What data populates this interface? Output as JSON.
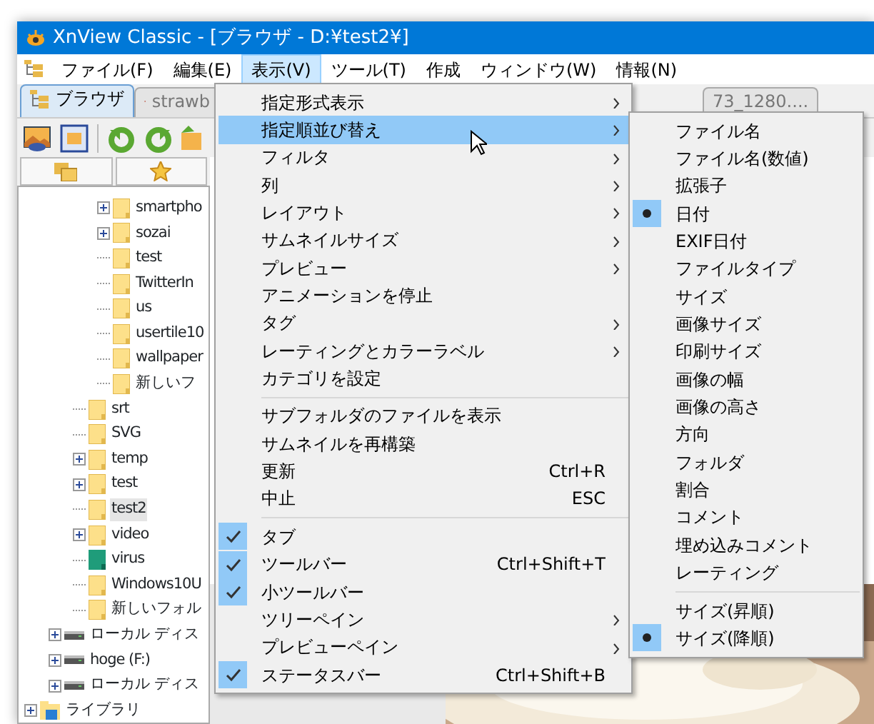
{
  "window": {
    "title": "XnView Classic - [ブラウザ - D:¥test2¥]"
  },
  "menu_bar": [
    {
      "label": "ファイル(F)",
      "selected": false
    },
    {
      "label": "編集(E)",
      "selected": false
    },
    {
      "label": "表示(V)",
      "selected": true
    },
    {
      "label": "ツール(T)",
      "selected": false
    },
    {
      "label": "作成",
      "selected": false
    },
    {
      "label": "ウィンドウ(W)",
      "selected": false
    },
    {
      "label": "情報(N)",
      "selected": false
    }
  ],
  "tabs": [
    {
      "label": "ブラウザ",
      "selected": true
    },
    {
      "label": "strawb",
      "selected": false
    },
    {
      "label": "73_1280....",
      "selected": false
    }
  ],
  "tree": [
    {
      "children": [
        {
          "children": [
            {
              "children": [
                {
                  "label": "smartpho",
                  "kind": "folder",
                  "expander": true,
                  "selected": false
                },
                {
                  "label": "sozai",
                  "kind": "folder",
                  "expander": true,
                  "selected": false
                },
                {
                  "label": "test",
                  "kind": "folder",
                  "expander": false,
                  "selected": false
                },
                {
                  "label": "TwitterIn",
                  "kind": "folder",
                  "expander": false,
                  "selected": false
                },
                {
                  "label": "us",
                  "kind": "folder",
                  "expander": false,
                  "selected": false
                },
                {
                  "label": "usertile10",
                  "kind": "folder",
                  "expander": false,
                  "selected": false
                },
                {
                  "label": "wallpaper",
                  "kind": "folder",
                  "expander": false,
                  "selected": false
                },
                {
                  "label": "新しいフ",
                  "kind": "folder",
                  "expander": false,
                  "selected": false
                }
              ]
            },
            {
              "label": "srt",
              "kind": "folder",
              "expander": false,
              "selected": false
            },
            {
              "label": "SVG",
              "kind": "folder",
              "expander": false,
              "selected": false
            },
            {
              "label": "temp",
              "kind": "folder",
              "expander": true,
              "selected": false
            },
            {
              "label": "test",
              "kind": "folder",
              "expander": true,
              "selected": false
            },
            {
              "label": "test2",
              "kind": "folder",
              "expander": false,
              "selected": true
            },
            {
              "label": "video",
              "kind": "folder",
              "expander": true,
              "selected": false
            },
            {
              "label": "virus",
              "kind": "folder_teal",
              "expander": false,
              "selected": false
            },
            {
              "label": "Windows10U",
              "kind": "folder",
              "expander": false,
              "selected": false
            },
            {
              "label": "新しいフォル",
              "kind": "folder",
              "expander": false,
              "selected": false
            }
          ]
        },
        {
          "label": "ローカル ディス",
          "kind": "drive",
          "expander": true,
          "selected": false
        },
        {
          "label": "hoge (F:)",
          "kind": "drive",
          "expander": true,
          "selected": false
        },
        {
          "label": "ローカル ディス",
          "kind": "drive",
          "expander": true,
          "selected": false
        }
      ]
    },
    {
      "label": "ライブラリ",
      "kind": "library",
      "expander": true,
      "selected": false
    }
  ],
  "view_menu": [
    {
      "kind": "item",
      "label": "指定形式表示",
      "submenu": true,
      "checked": false,
      "selected": false
    },
    {
      "kind": "item",
      "label": "指定順並び替え",
      "submenu": true,
      "checked": false,
      "selected": true
    },
    {
      "kind": "item",
      "label": "フィルタ",
      "submenu": true,
      "checked": false,
      "selected": false
    },
    {
      "kind": "item",
      "label": "列",
      "submenu": true,
      "checked": false,
      "selected": false
    },
    {
      "kind": "item",
      "label": "レイアウト",
      "submenu": true,
      "checked": false,
      "selected": false
    },
    {
      "kind": "item",
      "label": "サムネイルサイズ",
      "submenu": true,
      "checked": false,
      "selected": false
    },
    {
      "kind": "item",
      "label": "プレビュー",
      "submenu": true,
      "checked": false,
      "selected": false
    },
    {
      "kind": "item",
      "label": "アニメーションを停止",
      "submenu": false,
      "checked": false,
      "selected": false
    },
    {
      "kind": "item",
      "label": "タグ",
      "submenu": true,
      "checked": false,
      "selected": false
    },
    {
      "kind": "item",
      "label": "レーティングとカラーラベル",
      "submenu": true,
      "checked": false,
      "selected": false
    },
    {
      "kind": "item",
      "label": "カテゴリを設定",
      "submenu": false,
      "checked": false,
      "selected": false
    },
    {
      "kind": "separator"
    },
    {
      "kind": "item",
      "label": "サブフォルダのファイルを表示",
      "submenu": false,
      "checked": false,
      "selected": false
    },
    {
      "kind": "item",
      "label": "サムネイルを再構築",
      "submenu": false,
      "checked": false,
      "selected": false
    },
    {
      "kind": "item",
      "label": "更新",
      "shortcut": "Ctrl+R",
      "submenu": false,
      "checked": false,
      "selected": false
    },
    {
      "kind": "item",
      "label": "中止",
      "shortcut": "ESC",
      "submenu": false,
      "checked": false,
      "selected": false
    },
    {
      "kind": "separator"
    },
    {
      "kind": "item",
      "label": "タブ",
      "submenu": false,
      "checked": true,
      "selected": false
    },
    {
      "kind": "item",
      "label": "ツールバー",
      "shortcut": "Ctrl+Shift+T",
      "submenu": false,
      "checked": true,
      "selected": false
    },
    {
      "kind": "item",
      "label": "小ツールバー",
      "submenu": false,
      "checked": true,
      "selected": false
    },
    {
      "kind": "item",
      "label": "ツリーペイン",
      "submenu": true,
      "checked": false,
      "selected": false
    },
    {
      "kind": "item",
      "label": "プレビューペイン",
      "submenu": true,
      "checked": false,
      "selected": false
    },
    {
      "kind": "item",
      "label": "ステータスバー",
      "shortcut": "Ctrl+Shift+B",
      "submenu": false,
      "checked": true,
      "selected": false
    }
  ],
  "sort_submenu": [
    {
      "kind": "item",
      "label": "ファイル名",
      "checked": false
    },
    {
      "kind": "item",
      "label": "ファイル名(数値)",
      "checked": false
    },
    {
      "kind": "item",
      "label": "拡張子",
      "checked": false
    },
    {
      "kind": "item",
      "label": "日付",
      "checked": true
    },
    {
      "kind": "item",
      "label": "EXIF日付",
      "checked": false
    },
    {
      "kind": "item",
      "label": "ファイルタイプ",
      "checked": false
    },
    {
      "kind": "item",
      "label": "サイズ",
      "checked": false
    },
    {
      "kind": "item",
      "label": "画像サイズ",
      "checked": false
    },
    {
      "kind": "item",
      "label": "印刷サイズ",
      "checked": false
    },
    {
      "kind": "item",
      "label": "画像の幅",
      "checked": false
    },
    {
      "kind": "item",
      "label": "画像の高さ",
      "checked": false
    },
    {
      "kind": "item",
      "label": "方向",
      "checked": false
    },
    {
      "kind": "item",
      "label": "フォルダ",
      "checked": false
    },
    {
      "kind": "item",
      "label": "割合",
      "checked": false
    },
    {
      "kind": "item",
      "label": "コメント",
      "checked": false
    },
    {
      "kind": "item",
      "label": "埋め込みコメント",
      "checked": false
    },
    {
      "kind": "item",
      "label": "レーティング",
      "checked": false
    },
    {
      "kind": "separator"
    },
    {
      "kind": "item",
      "label": "サイズ(昇順)",
      "checked": false
    },
    {
      "kind": "item",
      "label": "サイズ(降順)",
      "checked": true
    }
  ]
}
